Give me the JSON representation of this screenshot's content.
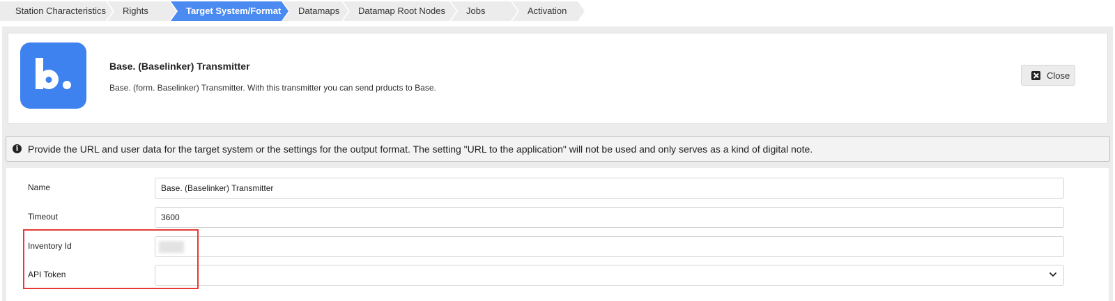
{
  "steps": [
    {
      "label": "Station Characteristics",
      "active": false
    },
    {
      "label": "Rights",
      "active": false
    },
    {
      "label": "Target System/Format",
      "active": true
    },
    {
      "label": "Datamaps",
      "active": false
    },
    {
      "label": "Datamap Root Nodes",
      "active": false
    },
    {
      "label": "Jobs",
      "active": false
    },
    {
      "label": "Activation",
      "active": false
    }
  ],
  "transmitter": {
    "title": "Base. (Baselinker) Transmitter",
    "description": "Base. (form. Baselinker) Transmitter. With this transmitter you can send prducts to Base.",
    "logo_icon": "base-b-logo",
    "logo_color": "#3d82ef"
  },
  "close_button": {
    "label": "Close",
    "icon": "close-icon"
  },
  "info": {
    "icon": "info-icon",
    "text": "Provide the URL and user data for the target system or the settings for the output format. The setting \"URL to the application\" will not be used and only serves as a kind of digital note."
  },
  "form": {
    "name": {
      "label": "Name",
      "value": "Base. (Baselinker) Transmitter"
    },
    "timeout": {
      "label": "Timeout",
      "value": "3600"
    },
    "inventory_id": {
      "label": "Inventory Id",
      "value": ""
    },
    "api_token": {
      "label": "API Token",
      "value": ""
    }
  },
  "colors": {
    "active_step": "#4b8af0",
    "highlight": "#e53935"
  }
}
